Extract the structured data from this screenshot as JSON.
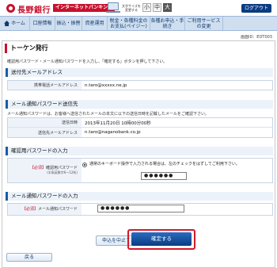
{
  "header": {
    "bank_name": "長野銀行",
    "ib_label": "インターネットバンキング",
    "font_size_label": "文字サイズを変更する",
    "font_sizes": [
      "小",
      "中",
      "大"
    ],
    "font_size_selected": "大",
    "logout_label": "ログアウト"
  },
  "nav": {
    "items": [
      "ホーム",
      "口座情報",
      "振込・振替",
      "資産運用",
      "税金・各種料金のお支払(ペイジー)",
      "各種お申込・手続き",
      "ご利用サービスの変更"
    ]
  },
  "page_id": "画面ID：EOT003",
  "page_title": "トーケン発行",
  "intro": "確認用パスワード・メール通知パスワードを入力し、「確定する」ボタンを押して下さい。",
  "section_address": {
    "title": "送付先メールアドレス",
    "label": "携帯電話メールアドレス",
    "value": "n.taro@xxxxx.ne.jp"
  },
  "section_notify": {
    "title": "メール通知パスワード送信先",
    "desc": "メール通知パスワードは、お客様へ送信されたメールの本文に以下の送信日時を記載したメールをご確認下さい。",
    "rows": [
      {
        "label": "送信日時",
        "value": "2013年11月20日 10時00分00秒"
      },
      {
        "label": "送信先メールアドレス",
        "value": "n.taro@naganobank.co.jp"
      }
    ]
  },
  "section_confirm": {
    "title": "確認用パスワードの入力",
    "required": "【必須】",
    "label": "確認用パスワード",
    "sub": "(半角英数字6〜12桁)",
    "radio_text": "通常のキーボード操作で入力される場合は、左のチェックをはずしてご利用下さい。",
    "masked": "●●●●●●"
  },
  "section_mail": {
    "title": "メール通知パスワードの入力",
    "required": "【必須】",
    "label": "メール通知パスワード",
    "masked": "●●●●●●"
  },
  "buttons": {
    "cancel": "申込を中止する",
    "confirm": "確定する",
    "back": "戻る"
  },
  "colors": {
    "brand_red": "#c8102e",
    "brand_blue": "#0b3c82"
  }
}
